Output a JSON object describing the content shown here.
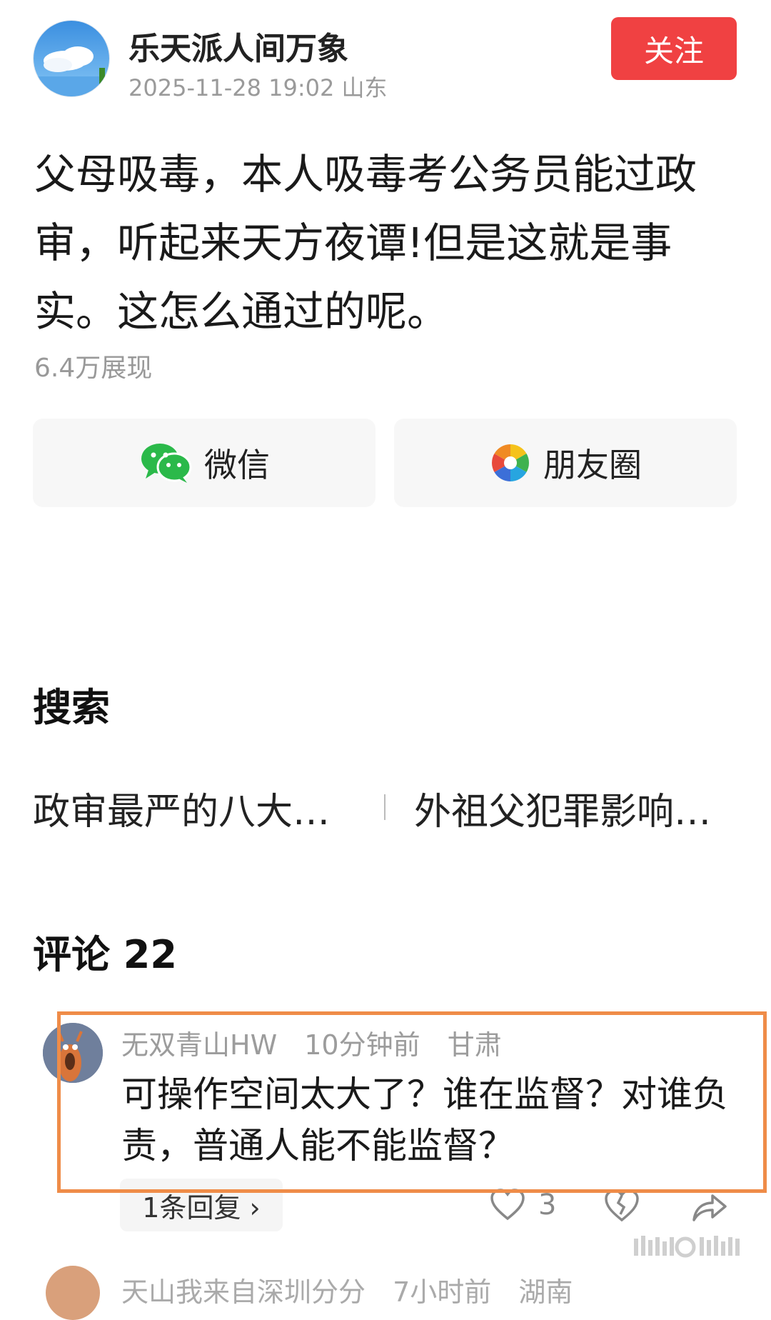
{
  "header": {
    "author_name": "乐天派人间万象",
    "date": "2025-11-28 19:02",
    "location": "山东",
    "follow_label": "关注"
  },
  "post": {
    "text": "父母吸毒，本人吸毒考公务员能过政审，听起来天方夜谭!但是这就是事实。这怎么通过的呢。",
    "views": "6.4万展现"
  },
  "share": {
    "wechat_label": "微信",
    "moments_label": "朋友圈"
  },
  "search": {
    "title": "搜索",
    "items": [
      "政审最严的八大…",
      "外祖父犯罪影响…"
    ]
  },
  "comments": {
    "title": "评论 22",
    "items": [
      {
        "user": "无双青山HW",
        "time": "10分钟前",
        "location": "甘肃",
        "text": "可操作空间太大了？谁在监督？对谁负责，普通人能不能监督？",
        "replies_label": "1条回复 ›",
        "likes": "3"
      },
      {
        "user": "天山我来自深圳分分",
        "time": "7小时前",
        "location": "湖南"
      }
    ]
  },
  "colors": {
    "follow": "#f04142",
    "highlight_border": "#ef8c48",
    "wechat": "#2bb94a"
  }
}
